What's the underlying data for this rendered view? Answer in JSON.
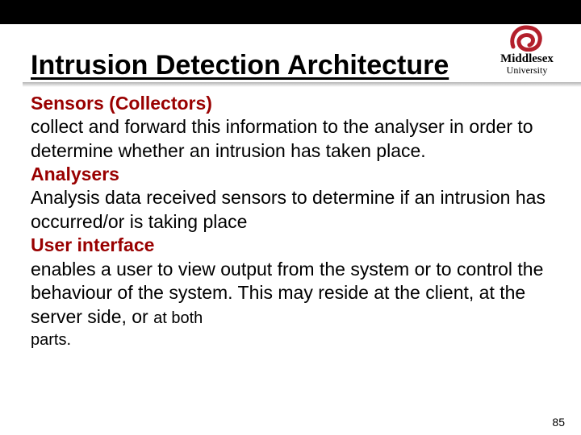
{
  "logo": {
    "name": "Middlesex",
    "sub": "University"
  },
  "title": "Intrusion Detection Architecture",
  "sections": {
    "s1_head": "Sensors (Collectors)",
    "s1_body": "collect and forward this information to the analyser in order to determine whether an intrusion has taken place.",
    "s2_head": "Analysers",
    "s2_body": "Analysis data received sensors to determine if an intrusion has occurred/or is taking place",
    "s3_head": "User interface",
    "s3_body_a": "enables a user to view output from the system or to control the behaviour of the system. This may reside at the client, at the server side, or ",
    "s3_body_b": "at both",
    "s3_body_c": "parts."
  },
  "page_number": "85"
}
